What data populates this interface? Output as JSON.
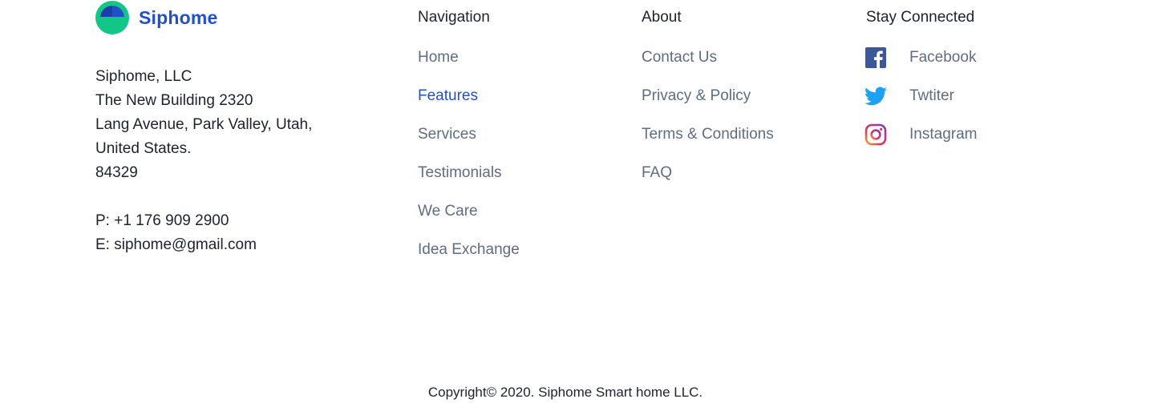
{
  "brand": {
    "name": "Siphome",
    "logo_icon": "siphome-logo-icon",
    "colors": {
      "blue": "#2150c8",
      "green": "#12c785",
      "dark_blue": "#1a3fa8"
    }
  },
  "address": {
    "lines": [
      "Siphome, LLC",
      "The New Building 2320",
      "Lang Avenue, Park Valley, Utah,",
      "United States.",
      "84329"
    ],
    "phone": "P: +1 176 909 2900",
    "email": "E: siphome@gmail.com"
  },
  "navigation": {
    "title": "Navigation",
    "items": [
      "Home",
      "Features",
      "Services",
      "Testimonials",
      "We Care",
      "Idea Exchange"
    ],
    "active_item": "Features"
  },
  "about": {
    "title": "About",
    "items": [
      "Contact Us",
      "Privacy & Policy",
      "Terms & Conditions",
      "FAQ"
    ]
  },
  "social": {
    "title": "Stay Connected",
    "items": [
      {
        "label": "Facebook",
        "icon": "facebook-icon",
        "color": "#3b5998"
      },
      {
        "label": "Twtiter",
        "icon": "twitter-icon",
        "color": "#1da1f2"
      },
      {
        "label": "Instagram",
        "icon": "instagram-icon",
        "color": "#c13584"
      }
    ]
  },
  "footer": {
    "copyright": "Copyright© 2020. Siphome Smart home LLC."
  },
  "colors": {
    "link": "#5f6c84",
    "link_active": "#2150c8",
    "text": "#1d222c",
    "background": "#ffffff"
  }
}
